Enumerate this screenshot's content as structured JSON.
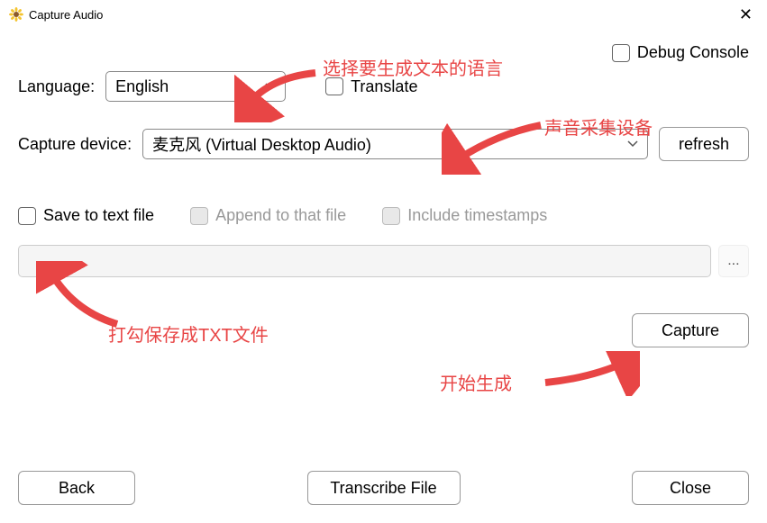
{
  "titlebar": {
    "title": "Capture Audio"
  },
  "debug": {
    "label": "Debug Console"
  },
  "language": {
    "label": "Language:",
    "selected": "English"
  },
  "translate": {
    "label": "Translate"
  },
  "captureDevice": {
    "label": "Capture device:",
    "selected": "麦克风 (Virtual Desktop Audio)"
  },
  "refresh": {
    "label": "refresh"
  },
  "saveToFile": {
    "label": "Save to text file"
  },
  "appendToFile": {
    "label": "Append to that file"
  },
  "includeTimestamps": {
    "label": "Include timestamps"
  },
  "browseBtn": {
    "label": "..."
  },
  "capture": {
    "label": "Capture"
  },
  "back": {
    "label": "Back"
  },
  "transcribeFile": {
    "label": "Transcribe File"
  },
  "close": {
    "label": "Close"
  },
  "annotations": {
    "langNote": "选择要生成文本的语言",
    "deviceNote": "声音采集设备",
    "saveNote": "打勾保存成TXT文件",
    "startNote": "开始生成"
  }
}
